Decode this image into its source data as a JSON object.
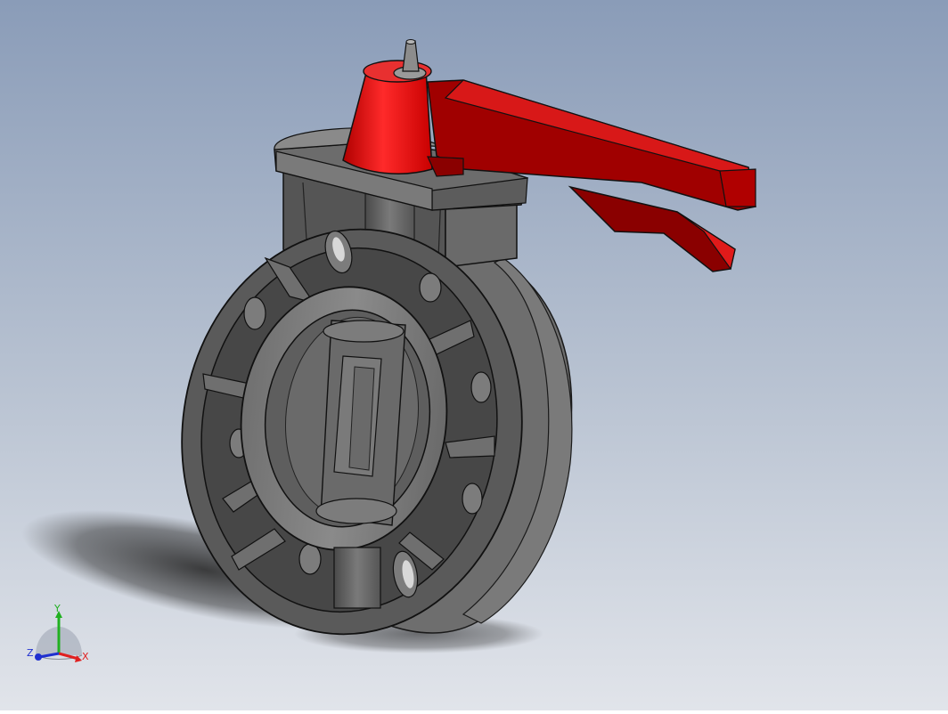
{
  "viewport": {
    "background_top": "#8a9cb8",
    "background_bottom": "#dfe3ea",
    "model": {
      "body_color": "#5a5a5a",
      "handle_color": "#e01a1a"
    }
  },
  "triad": {
    "x_label": "X",
    "y_label": "Y",
    "z_label": "Z",
    "x_color": "#e02020",
    "y_color": "#20b020",
    "z_color": "#2030d0"
  }
}
